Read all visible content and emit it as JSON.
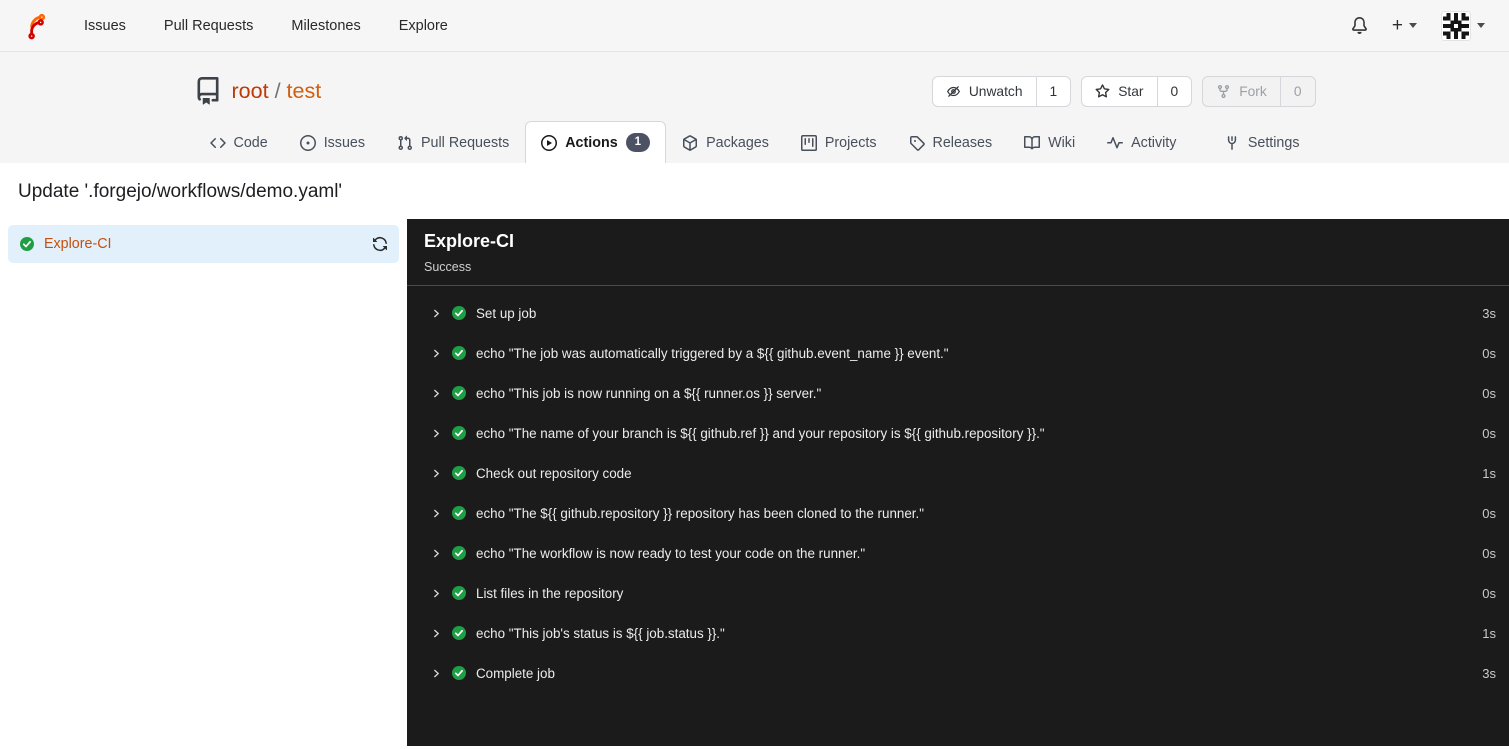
{
  "navbar": {
    "logo_icon": "forgejo-logo",
    "links": [
      "Issues",
      "Pull Requests",
      "Milestones",
      "Explore"
    ],
    "right": {
      "notifications_icon": "bell-icon",
      "create_label": "+",
      "avatar_icon": "identicon-avatar"
    }
  },
  "repo_header": {
    "repo_icon": "repo-icon",
    "owner": "root",
    "separator": "/",
    "name": "test",
    "actions": [
      {
        "icon": "eye-slash-icon",
        "label": "Unwatch",
        "count": "1",
        "disabled": false
      },
      {
        "icon": "star-icon",
        "label": "Star",
        "count": "0",
        "disabled": false
      },
      {
        "icon": "fork-icon",
        "label": "Fork",
        "count": "0",
        "disabled": true
      }
    ]
  },
  "tabs": [
    {
      "icon": "code-icon",
      "label": "Code",
      "active": false,
      "align_right": false
    },
    {
      "icon": "issue-icon",
      "label": "Issues",
      "active": false,
      "align_right": false
    },
    {
      "icon": "pull-request-icon",
      "label": "Pull Requests",
      "active": false,
      "align_right": false
    },
    {
      "icon": "play-circle-icon",
      "label": "Actions",
      "active": true,
      "badge": "1",
      "align_right": false
    },
    {
      "icon": "package-icon",
      "label": "Packages",
      "active": false,
      "align_right": false
    },
    {
      "icon": "project-icon",
      "label": "Projects",
      "active": false,
      "align_right": false
    },
    {
      "icon": "tag-icon",
      "label": "Releases",
      "active": false,
      "align_right": false
    },
    {
      "icon": "book-icon",
      "label": "Wiki",
      "active": false,
      "align_right": false
    },
    {
      "icon": "pulse-icon",
      "label": "Activity",
      "active": false,
      "align_right": false
    },
    {
      "icon": "wrench-icon",
      "label": "Settings",
      "active": false,
      "align_right": true
    }
  ],
  "run_view": {
    "commit_title": "Update '.forgejo/workflows/demo.yaml'",
    "jobs": [
      {
        "status_icon": "check-circle-icon",
        "name": "Explore-CI",
        "selected": true,
        "rerun_icon": "sync-icon"
      }
    ],
    "panel": {
      "title": "Explore-CI",
      "status": "Success",
      "steps": [
        {
          "name": "Set up job",
          "duration": "3s"
        },
        {
          "name": "echo \"The job was automatically triggered by a ${{ github.event_name }} event.\"",
          "duration": "0s"
        },
        {
          "name": "echo \"This job is now running on a ${{ runner.os }} server.\"",
          "duration": "0s"
        },
        {
          "name": "echo \"The name of your branch is ${{ github.ref }} and your repository is ${{ github.repository }}.\"",
          "duration": "0s"
        },
        {
          "name": "Check out repository code",
          "duration": "1s"
        },
        {
          "name": "echo \"The ${{ github.repository }} repository has been cloned to the runner.\"",
          "duration": "0s"
        },
        {
          "name": "echo \"The workflow is now ready to test your code on the runner.\"",
          "duration": "0s"
        },
        {
          "name": "List files in the repository",
          "duration": "0s"
        },
        {
          "name": "echo \"This job's status is ${{ job.status }}.\"",
          "duration": "1s"
        },
        {
          "name": "Complete job",
          "duration": "3s"
        }
      ]
    }
  },
  "colors": {
    "owner_link": "#c03a05",
    "repo_link": "#d15d0d",
    "success_green": "#1f9e45",
    "selected_job_bg": "#e2f0fc",
    "panel_bg": "#1b1b1b",
    "badge_bg": "#4c5264",
    "header_bg": "#f5f5f6",
    "logo_orange": "#ff6600",
    "logo_red": "#d40000"
  }
}
